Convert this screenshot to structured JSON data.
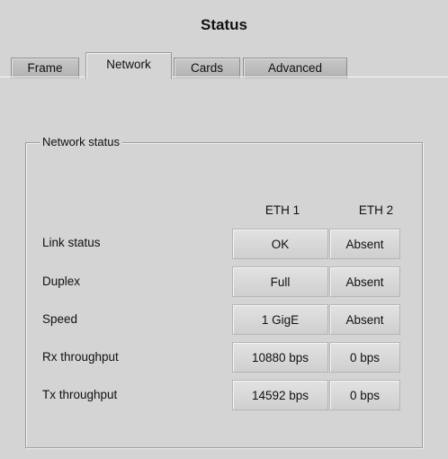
{
  "window": {
    "title": "Status"
  },
  "tabs": [
    {
      "label": "Frame",
      "active": false
    },
    {
      "label": "Network",
      "active": true
    },
    {
      "label": "Cards",
      "active": false
    },
    {
      "label": "Advanced",
      "active": false
    }
  ],
  "group": {
    "title": "Network status"
  },
  "columns": [
    "ETH 1",
    "ETH 2"
  ],
  "rows": [
    {
      "label": "Link status",
      "eth1": "OK",
      "eth2": "Absent"
    },
    {
      "label": "Duplex",
      "eth1": "Full",
      "eth2": "Absent"
    },
    {
      "label": "Speed",
      "eth1": "1 GigE",
      "eth2": "Absent"
    },
    {
      "label": "Rx throughput",
      "eth1": "10880 bps",
      "eth2": "0 bps"
    },
    {
      "label": "Tx throughput",
      "eth1": "14592 bps",
      "eth2": "0 bps"
    }
  ]
}
